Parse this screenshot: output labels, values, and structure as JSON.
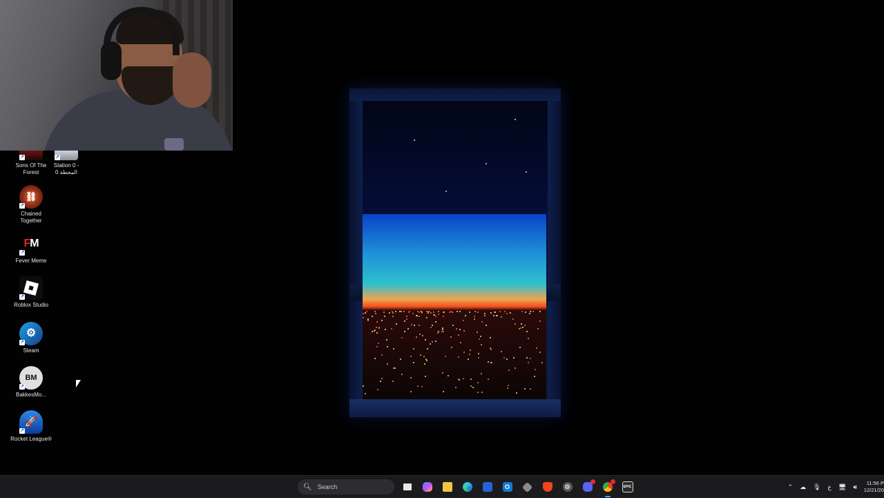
{
  "desktop": {
    "icons": [
      {
        "label": "Sons Of The Forest",
        "icon": "sons-of-the-forest-icon"
      },
      {
        "label": "Station 0 - المحطة 0",
        "icon": "station-0-icon"
      },
      {
        "label": "Chained Together",
        "icon": "chained-together-icon"
      },
      {
        "label": "Fever Meme",
        "icon": "fever-meme-icon",
        "glyph_text": "FM"
      },
      {
        "label": "Roblox Studio",
        "icon": "roblox-studio-icon"
      },
      {
        "label": "Steam",
        "icon": "steam-icon"
      },
      {
        "label": "BakkesMo...",
        "icon": "bakkesmod-icon",
        "glyph_text": "BM"
      },
      {
        "label": "Rocket League®",
        "icon": "rocket-league-icon"
      }
    ]
  },
  "webcam": {
    "description_icon": "webcam-overlay"
  },
  "taskbar": {
    "search_label": "Search",
    "apps": [
      {
        "name": "task-view",
        "icon": "task-view-icon"
      },
      {
        "name": "copilot",
        "icon": "copilot-icon"
      },
      {
        "name": "file-explorer",
        "icon": "folder-icon"
      },
      {
        "name": "edge",
        "icon": "edge-icon"
      },
      {
        "name": "store",
        "icon": "store-icon"
      },
      {
        "name": "outlook",
        "icon": "outlook-icon"
      },
      {
        "name": "app-hex",
        "icon": "hex-app-icon"
      },
      {
        "name": "brave",
        "icon": "brave-icon"
      },
      {
        "name": "app-settings",
        "icon": "gear-app-icon"
      },
      {
        "name": "discord",
        "icon": "discord-icon"
      },
      {
        "name": "chrome",
        "icon": "chrome-icon"
      },
      {
        "name": "epic-games",
        "icon": "epic-games-icon"
      }
    ],
    "tray": {
      "keyboard_layout": "ع",
      "time": "11:56 P",
      "date": "12/21/20"
    }
  },
  "colors": {
    "taskbar_bg": "#1b1b1e",
    "accent": "#4ea5f5",
    "desktop_bg": "#020203"
  }
}
